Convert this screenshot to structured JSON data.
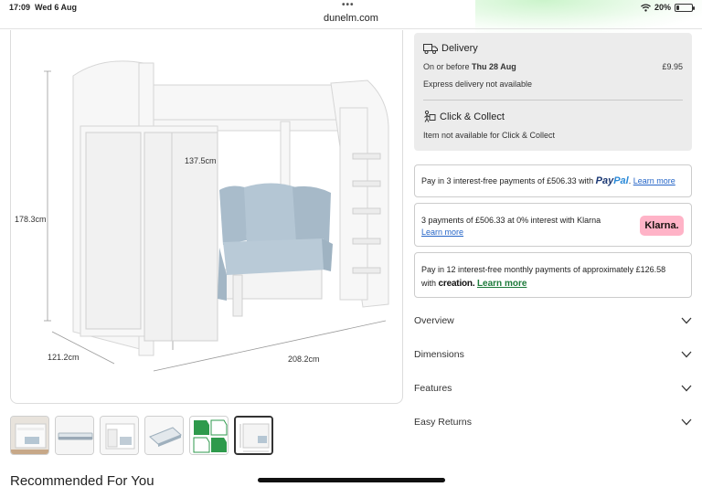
{
  "status_bar": {
    "time": "17:09",
    "date": "Wed 6 Aug",
    "battery": "20%",
    "battery_level": 0.2
  },
  "browser": {
    "address": "dunelm.com",
    "dots": "•••"
  },
  "product_image": {
    "dimensions": {
      "height_total": "178.3cm",
      "height_under": "137.5cm",
      "depth": "121.2cm",
      "width": "208.2cm"
    }
  },
  "thumbnails": [
    {
      "name": "bed-front-view",
      "active": false
    },
    {
      "name": "mattress-side-view",
      "active": false
    },
    {
      "name": "bed-open-view",
      "active": false
    },
    {
      "name": "mattress-angle-view",
      "active": false
    },
    {
      "name": "certification-badges",
      "active": false
    },
    {
      "name": "dimensions-diagram",
      "active": true
    }
  ],
  "recommended": {
    "title": "Recommended For You"
  },
  "delivery": {
    "title": "Delivery",
    "date_prefix": "On or before",
    "date": "Thu 28 Aug",
    "price": "£9.95",
    "express_note": "Express delivery not available",
    "collect_title": "Click & Collect",
    "collect_note": "Item not available for Click & Collect"
  },
  "paypal": {
    "text": "Pay in 3 interest-free payments of £506.33 with",
    "logo_pay": "Pay",
    "logo_pal": "Pal",
    "learn_more": "Learn more"
  },
  "klarna": {
    "text": "3 payments of £506.33 at 0% interest with Klarna",
    "learn_more": "Learn more",
    "badge": "Klarna."
  },
  "creation": {
    "text": "Pay in 12 interest-free monthly payments of approximately £126.58",
    "with": "with",
    "logo": "creation.",
    "learn_more": "Learn more"
  },
  "accordions": [
    {
      "label": "Overview"
    },
    {
      "label": "Dimensions"
    },
    {
      "label": "Features"
    },
    {
      "label": "Easy Returns"
    }
  ],
  "colors": {
    "link": "#2565c7",
    "klarna_pink": "#ffb3c7",
    "creation_green": "#1c7a3a",
    "panel_grey": "#ececec"
  }
}
